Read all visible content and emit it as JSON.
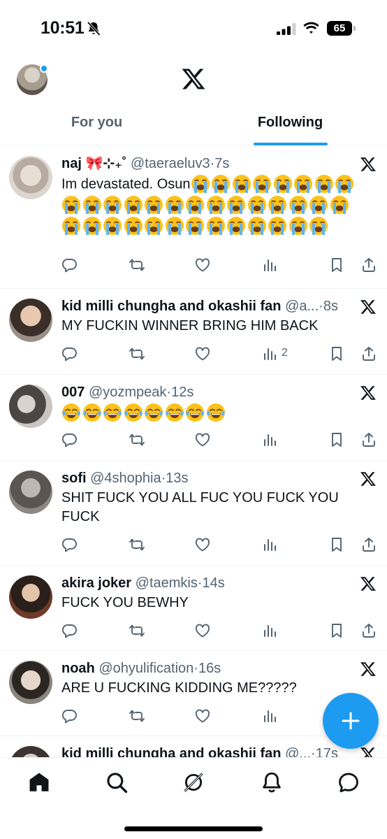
{
  "status_bar": {
    "time": "10:51",
    "battery": "65"
  },
  "tabs": [
    {
      "label": "For you",
      "active": false
    },
    {
      "label": "Following",
      "active": true
    }
  ],
  "colors": {
    "accent": "#1d9bf0",
    "secondary_text": "#536471",
    "primary_text": "#0f1419",
    "divider": "#eff3f4"
  },
  "tweets": [
    {
      "name": "naj 🎀⊹₊˚",
      "handle": "@taeraeluv3",
      "dot": "·",
      "time": "7s",
      "text": "Im devastated. Osun",
      "emoji_name": "loudly-crying-face",
      "emoji_count": 35,
      "views": ""
    },
    {
      "name": "kid milli chungha and okashii fan",
      "handle": "@a...",
      "dot": "·",
      "time": "8s",
      "text": "MY FUCKIN WINNER BRING HIM BACK",
      "emoji_name": "",
      "emoji_count": 0,
      "views": "2"
    },
    {
      "name": "007",
      "handle": "@yozmpeak",
      "dot": "·",
      "time": "12s",
      "text": "",
      "emoji_name": "face-with-tears-of-joy",
      "emoji_count": 8,
      "views": ""
    },
    {
      "name": "sofi",
      "handle": "@4shophia",
      "dot": "·",
      "time": "13s",
      "text": "SHIT FUCK YOU ALL FUC YOU FUCK YOU FUCK",
      "emoji_name": "",
      "emoji_count": 0,
      "views": ""
    },
    {
      "name": "akira joker",
      "handle": "@taemkis",
      "dot": "·",
      "time": "14s",
      "text": "FUCK YOU BEWHY",
      "emoji_name": "",
      "emoji_count": 0,
      "views": ""
    },
    {
      "name": "noah",
      "handle": "@ohyulification",
      "dot": "·",
      "time": "16s",
      "text": "ARE U FUCKING KIDDING ME?????",
      "emoji_name": "",
      "emoji_count": 0,
      "views": ""
    },
    {
      "name": "kid milli chungha and okashii fan",
      "handle": "@...",
      "dot": "·",
      "time": "17s",
      "text": "",
      "emoji_name": "",
      "emoji_count": 0,
      "views": ""
    }
  ],
  "bottom_nav": [
    "home-icon",
    "search-icon",
    "grok-icon",
    "notifications-icon",
    "messages-icon"
  ],
  "fab_icon": "plus-icon"
}
